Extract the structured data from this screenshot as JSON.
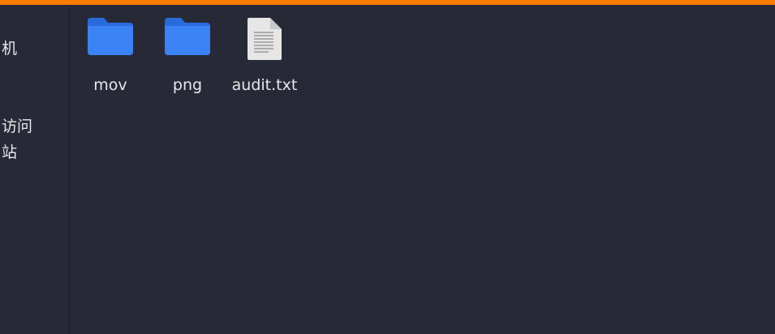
{
  "window": {
    "accent_color": "#ff7c00",
    "background_color": "#272a36"
  },
  "sidebar": {
    "items": [
      {
        "label": "机",
        "icon": ""
      },
      {
        "label": "访问",
        "icon": ""
      },
      {
        "label": "站",
        "icon": ""
      }
    ]
  },
  "files": [
    {
      "name": "mov",
      "type": "folder",
      "icon": "folder-icon",
      "color": "#3b82f6"
    },
    {
      "name": "png",
      "type": "folder",
      "icon": "folder-icon",
      "color": "#3b82f6"
    },
    {
      "name": "audit.txt",
      "type": "text-file",
      "icon": "text-file-icon",
      "color": "#e6e6e6"
    }
  ]
}
